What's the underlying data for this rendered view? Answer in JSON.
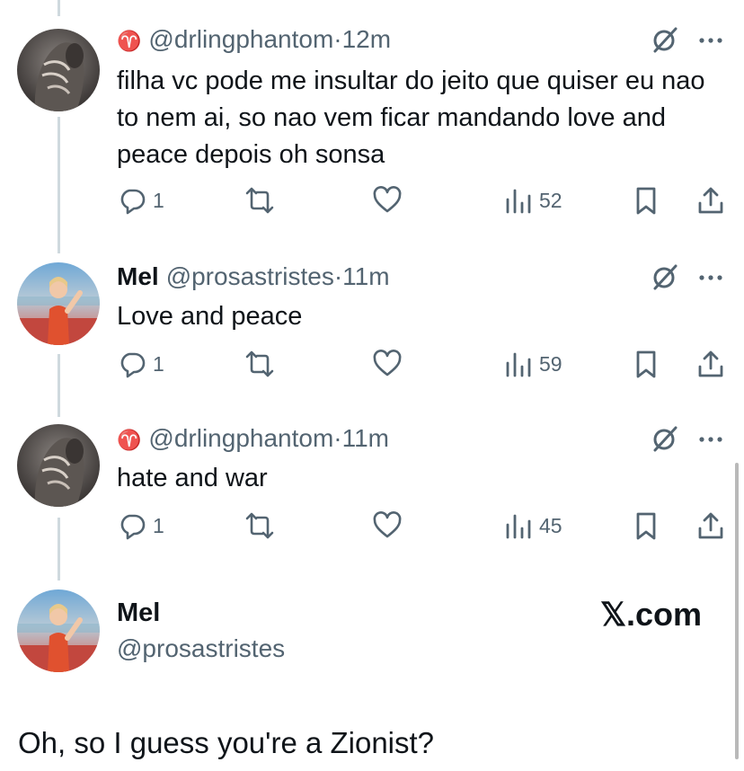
{
  "tweets": [
    {
      "zodiac_icon": "♈",
      "name": "",
      "handle": "@drlingphantom",
      "separator": "·",
      "time": "12m",
      "text": "filha vc pode me insultar do jeito que quiser eu nao to nem ai, so nao vem ficar mandando love and peace depois oh sonsa",
      "replies": "1",
      "views": "52",
      "avatar": "dark-hand-photo"
    },
    {
      "zodiac_icon": "",
      "name": "Mel",
      "handle": "@prosastristes",
      "separator": "·",
      "time": "11m",
      "text": "Love and peace",
      "replies": "1",
      "views": "59",
      "avatar": "red-sequin-singer-photo"
    },
    {
      "zodiac_icon": "♈",
      "name": "",
      "handle": "@drlingphantom",
      "separator": "·",
      "time": "11m",
      "text": "hate and war",
      "replies": "1",
      "views": "45",
      "avatar": "dark-hand-photo"
    }
  ],
  "main_tweet": {
    "name": "Mel",
    "handle": "@prosastristes",
    "text": "Oh, so I guess you're a Zionist?",
    "watermark": "𝕏.com"
  },
  "colors": {
    "text": "#0f1419",
    "muted": "#536471",
    "thread_line": "#cfd9de"
  },
  "icons": [
    "reply-icon",
    "retweet-icon",
    "like-icon",
    "views-icon",
    "bookmark-icon",
    "share-icon",
    "grok-icon",
    "more-icon",
    "aries-icon"
  ]
}
